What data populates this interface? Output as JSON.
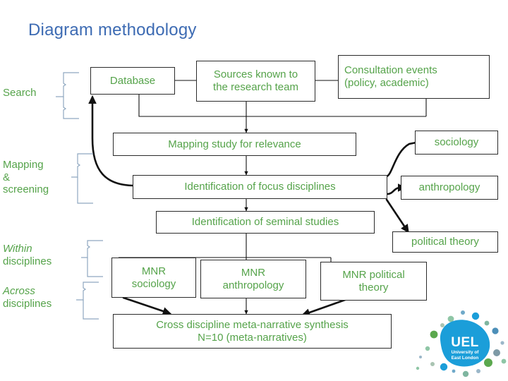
{
  "slide": {
    "title": "Diagram methodology",
    "title_color": "#3D6BB3",
    "node_text_color": "#55A34A",
    "node_border_color": "#2b2b2b",
    "background": "#ffffff"
  },
  "stage_labels": [
    {
      "id": "search",
      "text": "Search",
      "italic_lead": ""
    },
    {
      "id": "mapping-screening",
      "text": "Mapping\n&\nscreening",
      "italic_lead": ""
    },
    {
      "id": "within-disciplines",
      "text": "disciplines",
      "italic_lead": "Within"
    },
    {
      "id": "across-disciplines",
      "text": "disciplines",
      "italic_lead": "Across"
    }
  ],
  "nodes": [
    {
      "id": "database",
      "label": "Database"
    },
    {
      "id": "sources-known",
      "label": "Sources known to\nthe research team"
    },
    {
      "id": "consultation-events",
      "label": "Consultation events\n(policy, academic)"
    },
    {
      "id": "mapping-study",
      "label": "Mapping study for relevance"
    },
    {
      "id": "focus-disciplines",
      "label": "Identification of focus disciplines"
    },
    {
      "id": "seminal-studies",
      "label": "Identification of seminal studies"
    },
    {
      "id": "sociology",
      "label": "sociology"
    },
    {
      "id": "anthropology",
      "label": "anthropology"
    },
    {
      "id": "political-theory",
      "label": "political theory"
    },
    {
      "id": "mnr-sociology",
      "label": "MNR\nsociology"
    },
    {
      "id": "mnr-anthropology",
      "label": "MNR\nanthropology"
    },
    {
      "id": "mnr-political-theory",
      "label": "MNR political\ntheory"
    },
    {
      "id": "cross-synthesis",
      "label": "Cross discipline meta-narrative synthesis\nN=10 (meta-narratives)"
    }
  ],
  "logo": {
    "name": "UEL",
    "line1": "UEL",
    "line2": "University of",
    "line3": "East London",
    "blob_color": "#1B9ED9",
    "text_color": "#ffffff"
  }
}
